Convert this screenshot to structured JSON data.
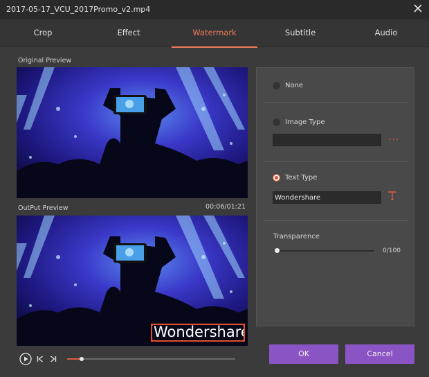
{
  "window": {
    "title": "2017-05-17_VCU_2017Promo_v2.mp4",
    "close_icon": "close-icon"
  },
  "tabs": [
    {
      "label": "Crop",
      "active": false
    },
    {
      "label": "Effect",
      "active": false
    },
    {
      "label": "Watermark",
      "active": true
    },
    {
      "label": "Subtitle",
      "active": false
    },
    {
      "label": "Audio",
      "active": false
    }
  ],
  "preview": {
    "original_label": "Original Preview",
    "output_label": "OutPut Preview",
    "timecode": "00:06/01:21",
    "watermark_overlay_text": "Wondershare"
  },
  "player": {
    "play_icon": "play-icon",
    "prev_icon": "previous-frame-icon",
    "next_icon": "next-frame-icon",
    "progress": 0.085
  },
  "watermark": {
    "options": {
      "none": {
        "label": "None",
        "selected": false
      },
      "image": {
        "label": "Image Type",
        "selected": false,
        "value": ""
      },
      "text": {
        "label": "Text Type",
        "selected": true,
        "value": "Wondershare"
      }
    },
    "browse_icon": "more-dots-icon",
    "font_icon": "text-font-icon",
    "transparence": {
      "label": "Transparence",
      "value": 0,
      "display": "0/100"
    }
  },
  "buttons": {
    "ok": "OK",
    "cancel": "Cancel"
  },
  "colors": {
    "accent": "#f07a5a",
    "button": "#8b54c4",
    "background": "#3b3b3b"
  }
}
